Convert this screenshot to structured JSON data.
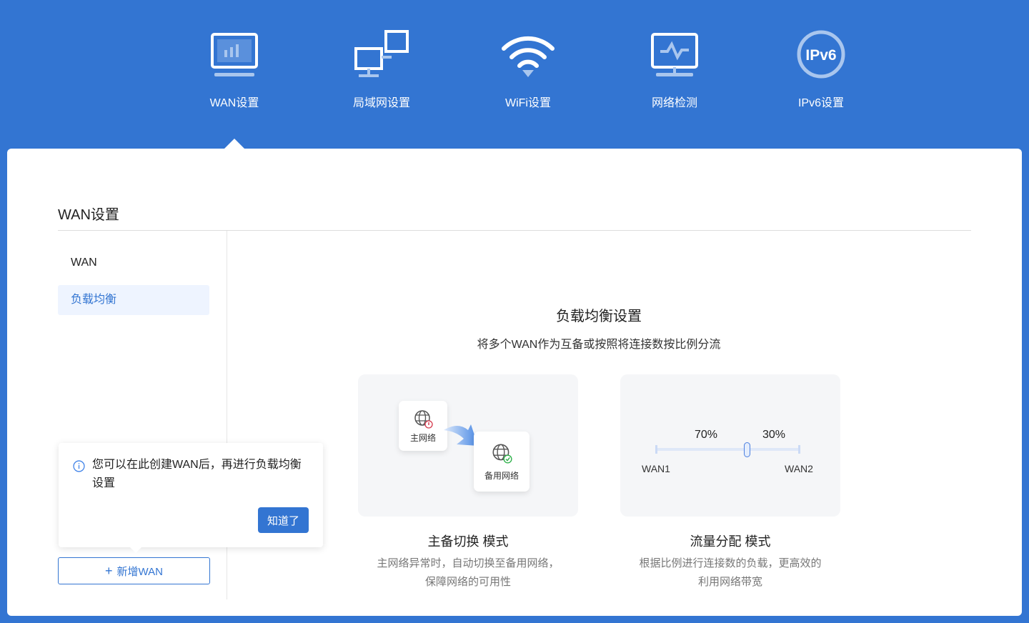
{
  "nav": [
    {
      "label": "WAN设置",
      "icon": "monitor-chart-icon"
    },
    {
      "label": "局域网设置",
      "icon": "lan-computers-icon"
    },
    {
      "label": "WiFi设置",
      "icon": "wifi-icon"
    },
    {
      "label": "网络检测",
      "icon": "monitor-pulse-icon"
    },
    {
      "label": "IPv6设置",
      "icon": "ipv6-icon",
      "icon_text": "IPv6"
    }
  ],
  "page": {
    "title": "WAN设置"
  },
  "sidebar": {
    "items": [
      {
        "label": "WAN"
      },
      {
        "label": "负载均衡",
        "active": true
      }
    ],
    "add_button": "新增WAN"
  },
  "main": {
    "heading": "负载均衡设置",
    "subheading": "将多个WAN作为互备或按照将连接数按比例分流",
    "modes": [
      {
        "title": "主备切换 模式",
        "desc1": "主网络异常时，自动切换至备用网络，",
        "desc2": "保障网络的可用性",
        "primary": "主网络",
        "backup": "备用网络"
      },
      {
        "title": "流量分配 模式",
        "desc1": "根据比例进行连接数的负载，更高效的",
        "desc2": "利用网络带宽",
        "left_pct": "70%",
        "right_pct": "30%",
        "left": "WAN1",
        "right": "WAN2",
        "split": 0.7
      }
    ]
  },
  "popover": {
    "text": "您可以在此创建WAN后，再进行负载均衡设置",
    "ok": "知道了"
  },
  "colors": {
    "brand": "#3375d2"
  }
}
